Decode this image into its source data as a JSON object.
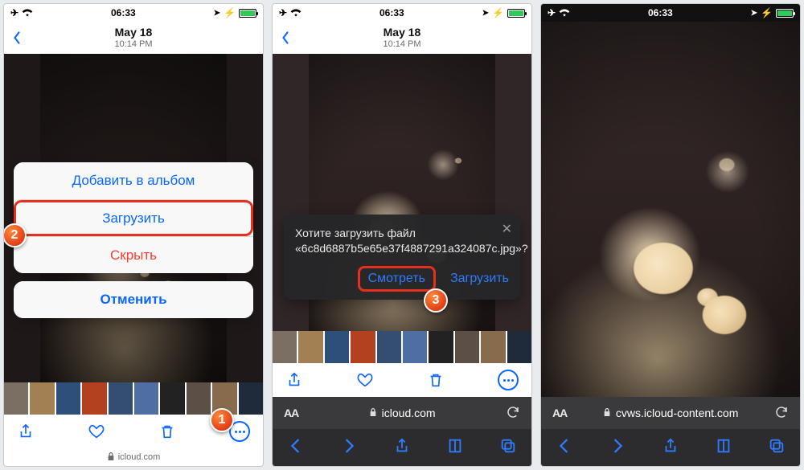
{
  "status": {
    "time": "06:33"
  },
  "panel1": {
    "nav": {
      "title": "May 18",
      "subtitle": "10:14 PM"
    },
    "sheet": {
      "add_to_album": "Добавить в альбом",
      "download": "Загрузить",
      "hide": "Скрыть",
      "cancel": "Отменить"
    },
    "url": "icloud.com",
    "steps": {
      "s1": "1",
      "s2": "2"
    }
  },
  "panel2": {
    "nav": {
      "title": "May 18",
      "subtitle": "10:14 PM"
    },
    "prompt": {
      "message": "Хотите загрузить файл «6c8d6887b5e65e37f4887291a324087c.jpg»?",
      "view": "Смотреть",
      "download": "Загрузить"
    },
    "url": "icloud.com",
    "step": "3"
  },
  "panel3": {
    "url": "cvws.icloud-content.com"
  }
}
